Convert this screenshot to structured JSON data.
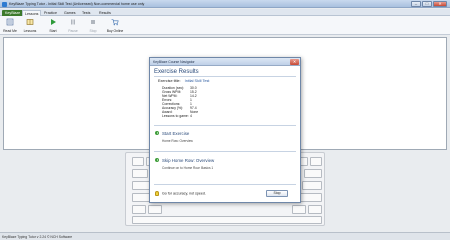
{
  "window": {
    "title": "KeyBlaze Typing Tutor - Initial Skill Test (Unlicensed) Non-commercial home use only",
    "minimize": "–",
    "maximize": "□",
    "close": "✕"
  },
  "menu": {
    "file": "KeyBlaze",
    "tabs": [
      "Lessons",
      "Practice",
      "Games",
      "Tests",
      "Results"
    ]
  },
  "ribbon": {
    "buttons": [
      {
        "label": "Read Me",
        "icon": "read-me-icon",
        "enabled": true
      },
      {
        "label": "Lessons",
        "icon": "lessons-icon",
        "enabled": true
      },
      {
        "label": "Start",
        "icon": "start-icon",
        "enabled": true
      },
      {
        "label": "Pause",
        "icon": "pause-icon",
        "enabled": false
      },
      {
        "label": "Stop",
        "icon": "stop-icon",
        "enabled": false
      },
      {
        "label": "Buy Online",
        "icon": "cart-icon",
        "enabled": true
      }
    ]
  },
  "dialog": {
    "title": "KeyBlaze Course Navigator",
    "heading": "Exercise Results",
    "exercise_label": "Exercise title:",
    "exercise_value": "Initial Skill Test",
    "stats": [
      {
        "label": "Duration (sec):",
        "value": "30.0"
      },
      {
        "label": "Gross WPM:",
        "value": "15.2"
      },
      {
        "label": "Net WPM:",
        "value": "14.2"
      },
      {
        "label": "Errors:",
        "value": "1"
      },
      {
        "label": "Corrections:",
        "value": "1"
      },
      {
        "label": "Accuracy (%):",
        "value": "97.4"
      },
      {
        "label": "Award:",
        "value": "None"
      },
      {
        "label": "Lessons to game:",
        "value": "4"
      }
    ],
    "option1_head": "Start Exercise",
    "option1_sub": "Home Row: Overview",
    "option2_head": "Skip Home Row: Overview",
    "option2_sub": "Continue on to Home Row: Basics 1",
    "tip": "Go for accuracy, not speed.",
    "stop_label": "Stop"
  },
  "status": {
    "text": "KeyBlaze Typing Tutor v 2.24 © NCH Software"
  }
}
